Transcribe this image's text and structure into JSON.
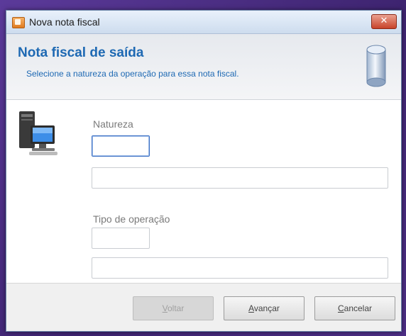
{
  "window": {
    "title": "Nova nota fiscal",
    "close_label": "✕"
  },
  "header": {
    "title": "Nota fiscal de saída",
    "subtitle": "Selecione a natureza da operação para essa nota fiscal."
  },
  "form": {
    "natureza": {
      "label": "Natureza",
      "code_value": "",
      "description_value": ""
    },
    "tipo_operacao": {
      "label": "Tipo de operação",
      "code_value": "",
      "description_value": ""
    }
  },
  "footer": {
    "buttons": [
      {
        "mnemonic": "V",
        "rest": "oltar",
        "enabled": false
      },
      {
        "mnemonic": "A",
        "rest": "vançar",
        "enabled": true
      },
      {
        "mnemonic": "C",
        "rest": "ancelar",
        "enabled": true
      }
    ]
  },
  "icons": {
    "app": "app-icon",
    "close": "close-icon",
    "database": "database-icon",
    "computer": "computer-icon"
  }
}
